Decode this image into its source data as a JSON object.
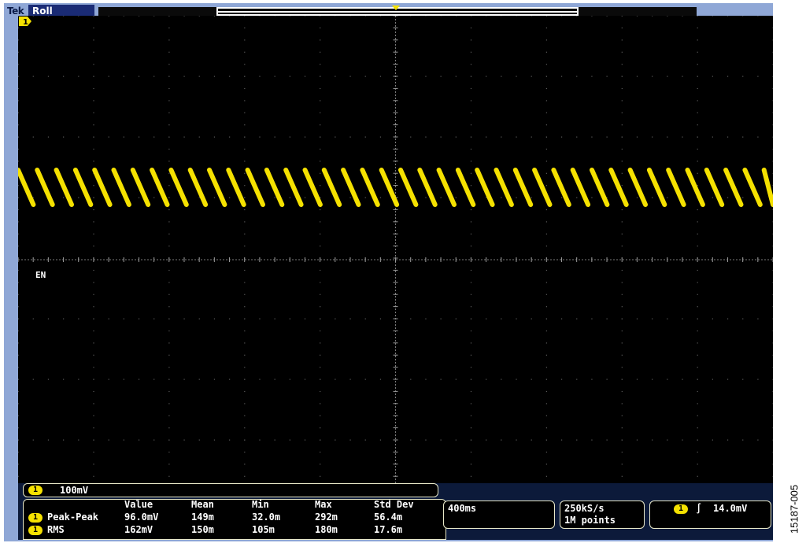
{
  "header": {
    "brand": "Tek",
    "mode": "Roll"
  },
  "channel": {
    "number": "1",
    "level_label": "EN",
    "color": "#f5e100"
  },
  "scale": {
    "volts_per_div": "100mV"
  },
  "measurements": {
    "columns": [
      "Value",
      "Mean",
      "Min",
      "Max",
      "Std Dev"
    ],
    "rows": [
      {
        "label": "Peak-Peak",
        "values": [
          "96.0mV",
          "149m",
          "32.0m",
          "292m",
          "56.4m"
        ]
      },
      {
        "label": "RMS",
        "values": [
          "162mV",
          "150m",
          "105m",
          "180m",
          "17.6m"
        ]
      }
    ]
  },
  "timebase": {
    "time_per_div": "400ms"
  },
  "acquisition": {
    "sample_rate": "250kS/s",
    "record_length": "1M points"
  },
  "trigger": {
    "channel": "1",
    "slope_symbol": "∫",
    "level": "14.0mV"
  },
  "figure_id": "15187-005",
  "colors": {
    "frame": "#8fa7d6",
    "screen": "#000000",
    "trace": "#f5e100",
    "status_bar": "#1a2b75"
  }
}
